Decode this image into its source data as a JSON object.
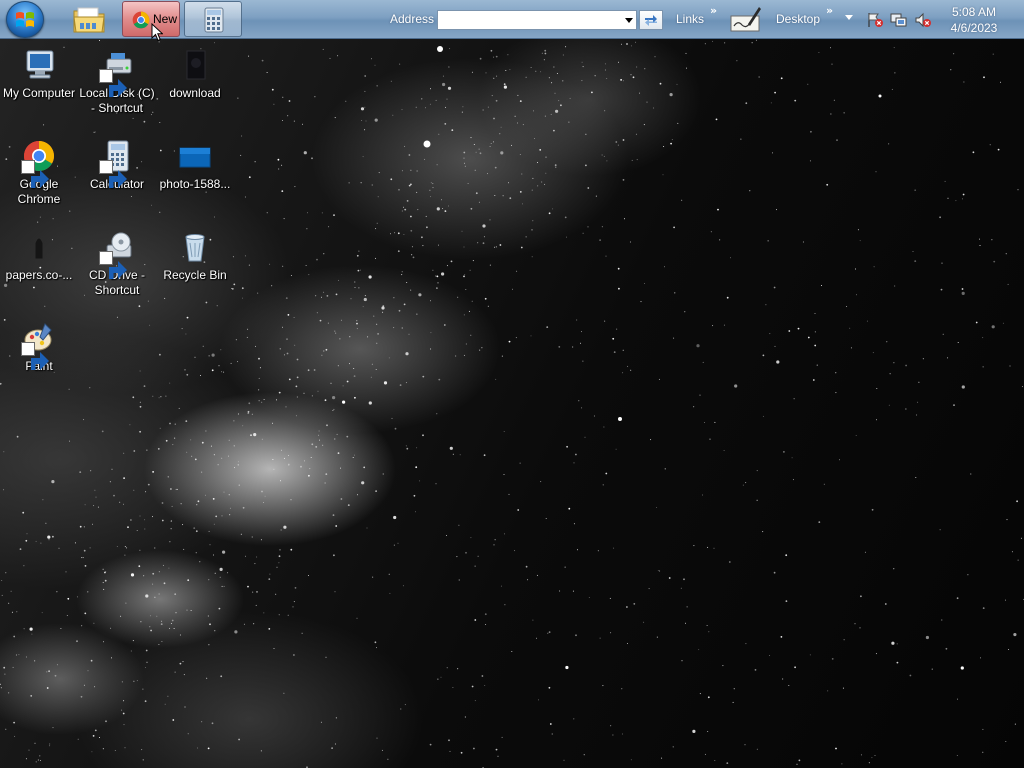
{
  "taskbar": {
    "chrome_button_text": "New",
    "address_label": "Address",
    "address_value": "",
    "links_label": "Links",
    "desktop_label": "Desktop",
    "clock_time": "5:08 AM",
    "clock_date": "4/6/2023"
  },
  "desktop_icons": [
    {
      "label": "My Computer"
    },
    {
      "label": "Local Disk (C) - Shortcut"
    },
    {
      "label": "download"
    },
    {
      "label": "Google Chrome"
    },
    {
      "label": "Calculator"
    },
    {
      "label": "photo-1588..."
    },
    {
      "label": "papers.co-..."
    },
    {
      "label": "CD Drive - Shortcut"
    },
    {
      "label": "Recycle Bin"
    },
    {
      "label": "Paint"
    }
  ],
  "colors": {
    "taskbar": "#7ea0c2",
    "chrome_active": "#d06a6a",
    "desktop_bg": "#050505"
  }
}
